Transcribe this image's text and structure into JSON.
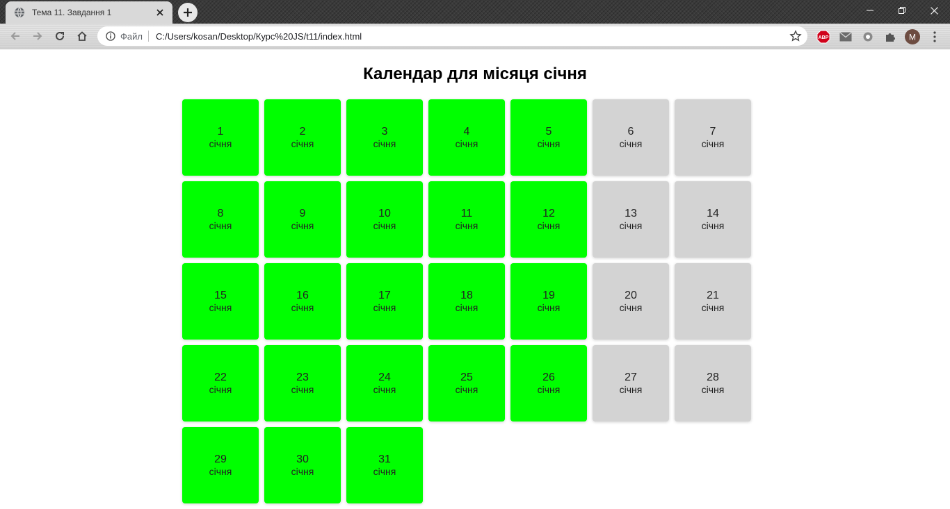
{
  "browser": {
    "tab_title": "Тема 11. Завдання 1",
    "scheme_label": "Файл",
    "url": "C:/Users/kosan/Desktop/Курс%20JS/t11/index.html",
    "profile_initial": "M",
    "adblock_label": "ABP"
  },
  "colors": {
    "workday": "#00ff00",
    "weekend": "#d3d3d3"
  },
  "page": {
    "title": "Календар для місяця січня"
  },
  "calendar": {
    "month_label": "січня",
    "days": [
      {
        "day": "1",
        "type": "workday"
      },
      {
        "day": "2",
        "type": "workday"
      },
      {
        "day": "3",
        "type": "workday"
      },
      {
        "day": "4",
        "type": "workday"
      },
      {
        "day": "5",
        "type": "workday"
      },
      {
        "day": "6",
        "type": "weekend"
      },
      {
        "day": "7",
        "type": "weekend"
      },
      {
        "day": "8",
        "type": "workday"
      },
      {
        "day": "9",
        "type": "workday"
      },
      {
        "day": "10",
        "type": "workday"
      },
      {
        "day": "11",
        "type": "workday"
      },
      {
        "day": "12",
        "type": "workday"
      },
      {
        "day": "13",
        "type": "weekend"
      },
      {
        "day": "14",
        "type": "weekend"
      },
      {
        "day": "15",
        "type": "workday"
      },
      {
        "day": "16",
        "type": "workday"
      },
      {
        "day": "17",
        "type": "workday"
      },
      {
        "day": "18",
        "type": "workday"
      },
      {
        "day": "19",
        "type": "workday"
      },
      {
        "day": "20",
        "type": "weekend"
      },
      {
        "day": "21",
        "type": "weekend"
      },
      {
        "day": "22",
        "type": "workday"
      },
      {
        "day": "23",
        "type": "workday"
      },
      {
        "day": "24",
        "type": "workday"
      },
      {
        "day": "25",
        "type": "workday"
      },
      {
        "day": "26",
        "type": "workday"
      },
      {
        "day": "27",
        "type": "weekend"
      },
      {
        "day": "28",
        "type": "weekend"
      },
      {
        "day": "29",
        "type": "workday"
      },
      {
        "day": "30",
        "type": "workday"
      },
      {
        "day": "31",
        "type": "workday"
      }
    ]
  }
}
